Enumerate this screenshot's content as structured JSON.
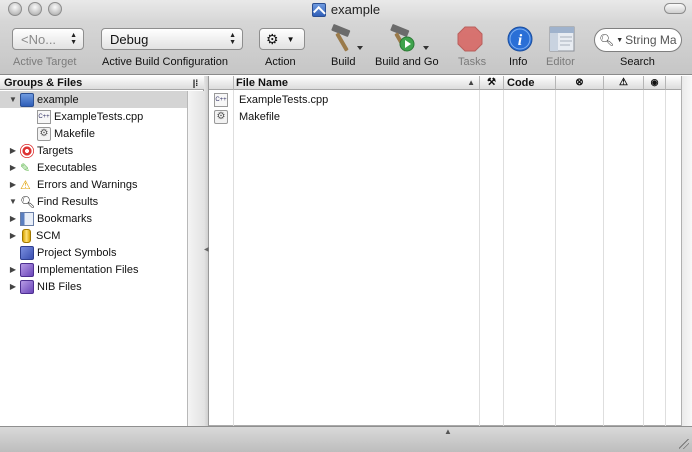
{
  "window": {
    "title": "example"
  },
  "toolbar": {
    "active_target": {
      "value": "<No...",
      "label": "Active Target"
    },
    "active_build_configuration": {
      "value": "Debug",
      "label": "Active Build Configuration"
    },
    "action": {
      "label": "Action"
    },
    "build": {
      "label": "Build"
    },
    "build_and_go": {
      "label": "Build and Go"
    },
    "tasks": {
      "label": "Tasks"
    },
    "info": {
      "label": "Info"
    },
    "editor": {
      "label": "Editor"
    },
    "search": {
      "placeholder": "String Ma",
      "label": "Search"
    }
  },
  "groups": {
    "header": "Groups & Files",
    "items": [
      {
        "label": "example",
        "icon": "xcode-project-icon",
        "expanded": true,
        "selected": true
      },
      {
        "label": "ExampleTests.cpp",
        "icon": "cpp-file-icon"
      },
      {
        "label": "Makefile",
        "icon": "makefile-icon"
      },
      {
        "label": "Targets",
        "icon": "targets-icon",
        "expanded": false
      },
      {
        "label": "Executables",
        "icon": "executables-icon",
        "expanded": false
      },
      {
        "label": "Errors and Warnings",
        "icon": "warning-icon",
        "expanded": false
      },
      {
        "label": "Find Results",
        "icon": "magnifier-icon",
        "expanded": true
      },
      {
        "label": "Bookmarks",
        "icon": "bookmarks-icon",
        "expanded": false
      },
      {
        "label": "SCM",
        "icon": "scm-icon",
        "expanded": false
      },
      {
        "label": "Project Symbols",
        "icon": "symbols-icon"
      },
      {
        "label": "Implementation Files",
        "icon": "smart-group-icon",
        "expanded": false
      },
      {
        "label": "NIB Files",
        "icon": "smart-group-icon",
        "expanded": false
      }
    ]
  },
  "file_list": {
    "columns": {
      "file_name": "File Name",
      "code": "Code"
    },
    "rows": [
      {
        "name": "ExampleTests.cpp",
        "icon": "cpp-file-icon"
      },
      {
        "name": "Makefile",
        "icon": "makefile-icon"
      }
    ]
  },
  "colors": {
    "selection": "#d4d4d4",
    "info_blue": "#2a6fd6",
    "tasks_red": "#d9534f"
  }
}
